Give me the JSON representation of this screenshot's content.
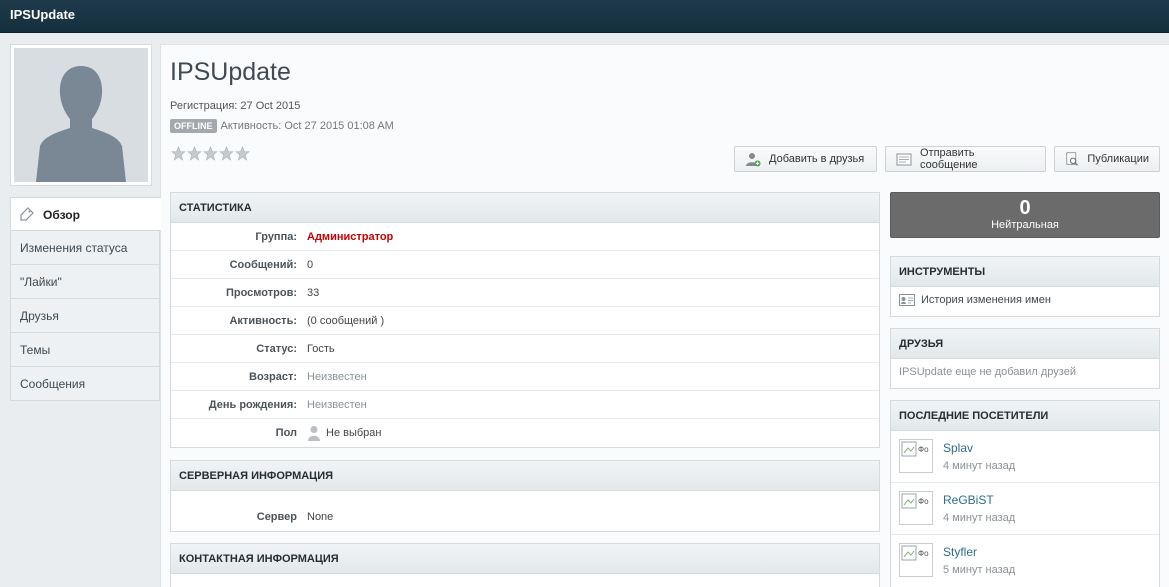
{
  "app": {
    "title": "IPSUpdate"
  },
  "profile": {
    "name": "IPSUpdate",
    "registration": "Регистрация: 27 Oct 2015",
    "status_badge": "OFFLINE",
    "activity": "Активность: Oct 27 2015 01:08 AM",
    "rating_stars": 5
  },
  "sidenav": {
    "items": [
      {
        "label": "Обзор"
      },
      {
        "label": "Изменения статуса"
      },
      {
        "label": "\"Лайки\""
      },
      {
        "label": "Друзья"
      },
      {
        "label": "Темы"
      },
      {
        "label": "Сообщения"
      }
    ]
  },
  "buttons": {
    "add_friend": "Добавить в друзья",
    "send_message": "Отправить сообщение",
    "publications": "Публикации"
  },
  "stats": {
    "title": "СТАТИСТИКА",
    "rows": [
      {
        "label": "Группа:",
        "value": "Администратор"
      },
      {
        "label": "Сообщений:",
        "value": "0"
      },
      {
        "label": "Просмотров:",
        "value": "33"
      },
      {
        "label": "Активность:",
        "value": "(0 сообщений )"
      },
      {
        "label": "Статус:",
        "value": "Гость"
      },
      {
        "label": "Возраст:",
        "value": "Неизвестен"
      },
      {
        "label": "День рождения:",
        "value": "Неизвестен"
      },
      {
        "label": "Пол",
        "value": "Не выбран"
      }
    ]
  },
  "server": {
    "title": "СЕРВЕРНАЯ ИНФОРМАЦИЯ",
    "rows": [
      {
        "label": "Сервер",
        "value": "None"
      }
    ]
  },
  "contact": {
    "title": "КОНТАКТНАЯ ИНФОРМАЦИЯ"
  },
  "reputation": {
    "value": "0",
    "label": "Нейтральная"
  },
  "tools": {
    "title": "ИНСТРУМЕНТЫ",
    "name_history": "История изменения имен"
  },
  "friends": {
    "title": "ДРУЗЬЯ",
    "empty_text": "IPSUpdate еще не добавил друзей"
  },
  "visitors": {
    "title": "ПОСЛЕДНИЕ ПОСЕТИТЕЛИ",
    "items": [
      {
        "name": "Splav",
        "time": "4 минут назад"
      },
      {
        "name": "ReGBiST",
        "time": "4 минут назад"
      },
      {
        "name": "Styfler",
        "time": "5 минут назад"
      }
    ]
  },
  "colors": {
    "accent_admin": "#cc0000",
    "topbar": "#1f3a4a",
    "reputation_bg": "#6b6b6b"
  }
}
